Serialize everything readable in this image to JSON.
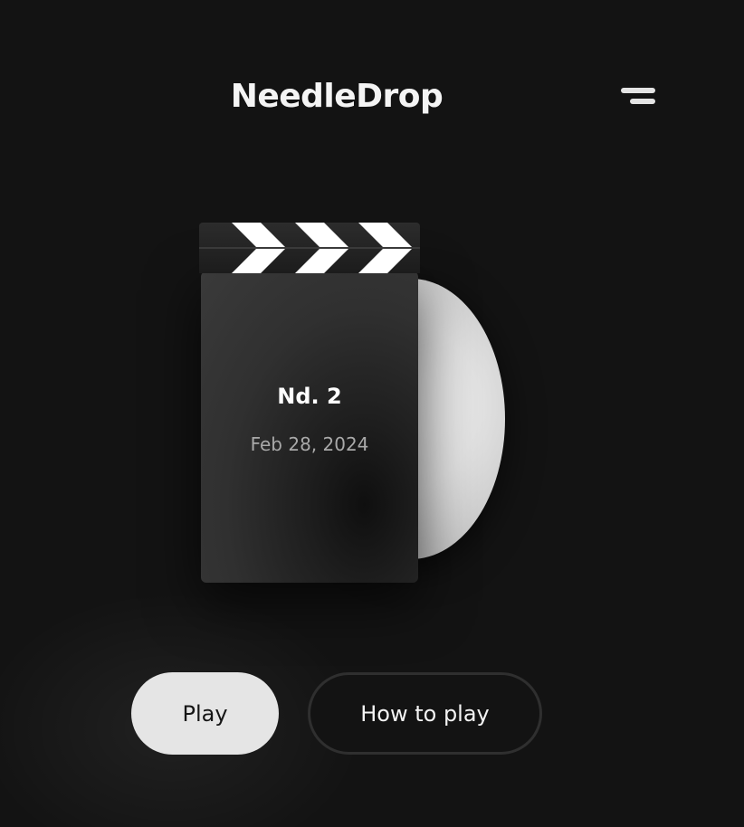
{
  "header": {
    "title": "NeedleDrop",
    "menu_icon": "menu-icon"
  },
  "puzzle": {
    "title": "Nd. 2",
    "date": "Feb 28, 2024",
    "clapper_icon": "clapperboard-icon",
    "record_icon": "vinyl-record-icon"
  },
  "actions": {
    "play_label": "Play",
    "how_to_play_label": "How to play"
  },
  "colors": {
    "background": "#131313",
    "primary_button": "#e5e5e5",
    "text": "#f4f4f4",
    "secondary_text": "#a9a9a9"
  }
}
